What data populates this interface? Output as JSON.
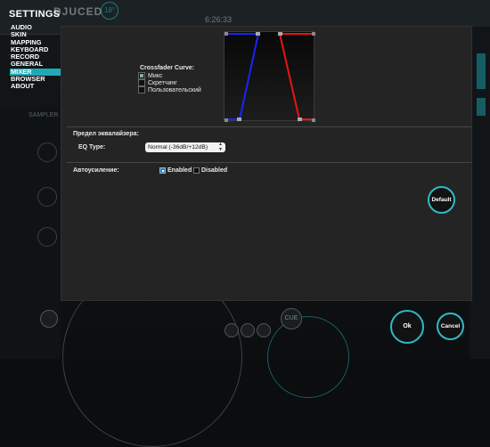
{
  "background_app": {
    "logo_text": "DJUCED",
    "logo_badge": "18°",
    "time_readout": "6:26:33",
    "sample_label": "SAMPLER",
    "cue_label": "CUE"
  },
  "settings": {
    "title": "SETTINGS",
    "nav": [
      {
        "label": "AUDIO",
        "active": false
      },
      {
        "label": "SKIN",
        "active": false
      },
      {
        "label": "MAPPING",
        "active": false
      },
      {
        "label": "KEYBOARD",
        "active": false
      },
      {
        "label": "RECORD",
        "active": false
      },
      {
        "label": "GENERAL",
        "active": false
      },
      {
        "label": "MIXER",
        "active": true
      },
      {
        "label": "BROWSER",
        "active": false
      },
      {
        "label": "ABOUT",
        "active": false
      }
    ]
  },
  "mixer": {
    "crossfader": {
      "label": "Crossfader Curve:",
      "options": [
        {
          "label": "Микс",
          "selected": true
        },
        {
          "label": "Скретчинг",
          "selected": false
        },
        {
          "label": "Пользовательский",
          "selected": false
        }
      ]
    },
    "eq_limit": {
      "section_label": "Предел эквалайзера:",
      "type_label": "EQ Type:",
      "selected_value": "Normal (-36dB/+12dB)"
    },
    "auto_gain": {
      "label": "Автоусиление:",
      "enabled_label": "Enabled",
      "disabled_label": "Disabled",
      "enabled": true
    },
    "default_button": "Default"
  },
  "footer": {
    "ok_label": "Ok",
    "cancel_label": "Cancel"
  },
  "colors": {
    "accent": "#2fb9c6",
    "curve_left": "#1a22ff",
    "curve_right": "#e81414",
    "nav_active": "#1fa9b8"
  }
}
